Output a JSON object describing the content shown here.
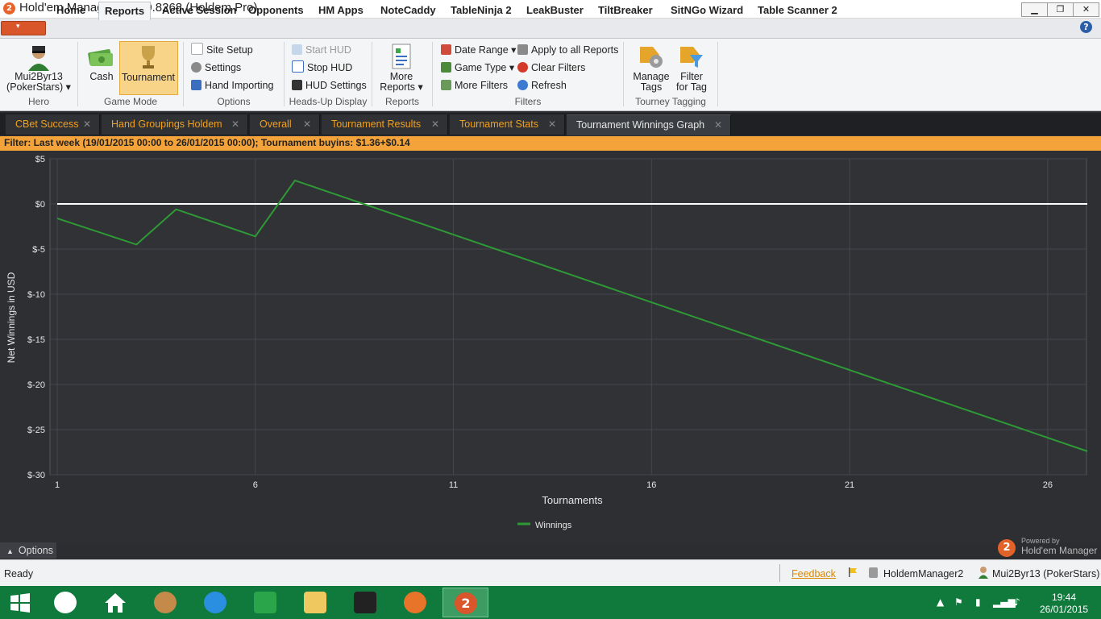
{
  "window": {
    "title": "Hold'em Manager - 2.0.0.8268 (Holdem Pro)",
    "minimize": "▁",
    "restore": "❐",
    "close": "✕"
  },
  "ribbon_tabs": [
    "Home",
    "Reports",
    "Active Session",
    "Opponents",
    "HM Apps",
    "NoteCaddy",
    "TableNinja 2",
    "LeakBuster",
    "TiltBreaker",
    "SitNGo Wizard",
    "Table Scanner 2"
  ],
  "ribbon": {
    "hero": {
      "name_line1": "Mui2Byr13",
      "name_line2": "(PokerStars) ▾",
      "group": "Hero"
    },
    "game_mode": {
      "cash": "Cash",
      "tournament": "Tournament",
      "group": "Game Mode"
    },
    "options": {
      "site_setup": "Site Setup",
      "settings": "Settings",
      "hand_importing": "Hand Importing",
      "group": "Options"
    },
    "hud": {
      "start": "Start HUD",
      "stop": "Stop HUD",
      "settings": "HUD Settings",
      "group": "Heads-Up Display"
    },
    "reports": {
      "more_line1": "More",
      "more_line2": "Reports ▾",
      "group": "Reports"
    },
    "filters": {
      "date_range": "Date Range ▾",
      "game_type": "Game Type ▾",
      "more_filters": "More Filters",
      "apply_all": "Apply to all Reports",
      "clear": "Clear Filters",
      "refresh": "Refresh",
      "group": "Filters"
    },
    "tagging": {
      "manage_line1": "Manage",
      "manage_line2": "Tags",
      "filter_line1": "Filter",
      "filter_line2": "for Tag",
      "group": "Tourney Tagging"
    }
  },
  "doc_tabs": [
    "CBet Success",
    "Hand Groupings Holdem",
    "Overall",
    "Tournament Results",
    "Tournament Stats",
    "Tournament Winnings Graph"
  ],
  "doc_tab_close": "✕",
  "filter_text": "Filter: Last week (19/01/2015 00:00 to 26/01/2015 00:00); Tournament buyins: $1.36+$0.14",
  "chart_data": {
    "type": "line",
    "xlabel": "Tournaments",
    "ylabel": "Net Winnings in USD",
    "xlim": [
      1,
      27
    ],
    "ylim": [
      -30,
      5
    ],
    "x_ticks": [
      1,
      6,
      11,
      16,
      21,
      26
    ],
    "y_ticks": [
      5,
      0,
      -5,
      -10,
      -15,
      -20,
      -25,
      -30
    ],
    "y_tick_labels": [
      "$5",
      "$0",
      "$-5",
      "$-10",
      "$-15",
      "$-20",
      "$-25",
      "$-30"
    ],
    "zero_line": 0,
    "grid": true,
    "legend": "bottom-center",
    "series": [
      {
        "name": "Winnings",
        "color": "#2e9a35",
        "x": [
          1,
          3,
          4,
          6,
          7,
          27
        ],
        "y": [
          -1.6,
          -4.5,
          -0.6,
          -3.6,
          2.6,
          -27.4
        ]
      }
    ]
  },
  "options_label": "Options",
  "logo": {
    "powered_by": "Powered by",
    "product": "Hold'em Manager"
  },
  "status": {
    "ready": "Ready",
    "feedback": "Feedback",
    "db": "HoldemManager2",
    "player": "Mui2Byr13 (PokerStars)"
  },
  "clock": {
    "time": "19:44",
    "date": "26/01/2015"
  },
  "colors": {
    "accent": "#f3a339",
    "chart_bg": "#2d2f33",
    "taskbar": "#0f7a3c"
  }
}
